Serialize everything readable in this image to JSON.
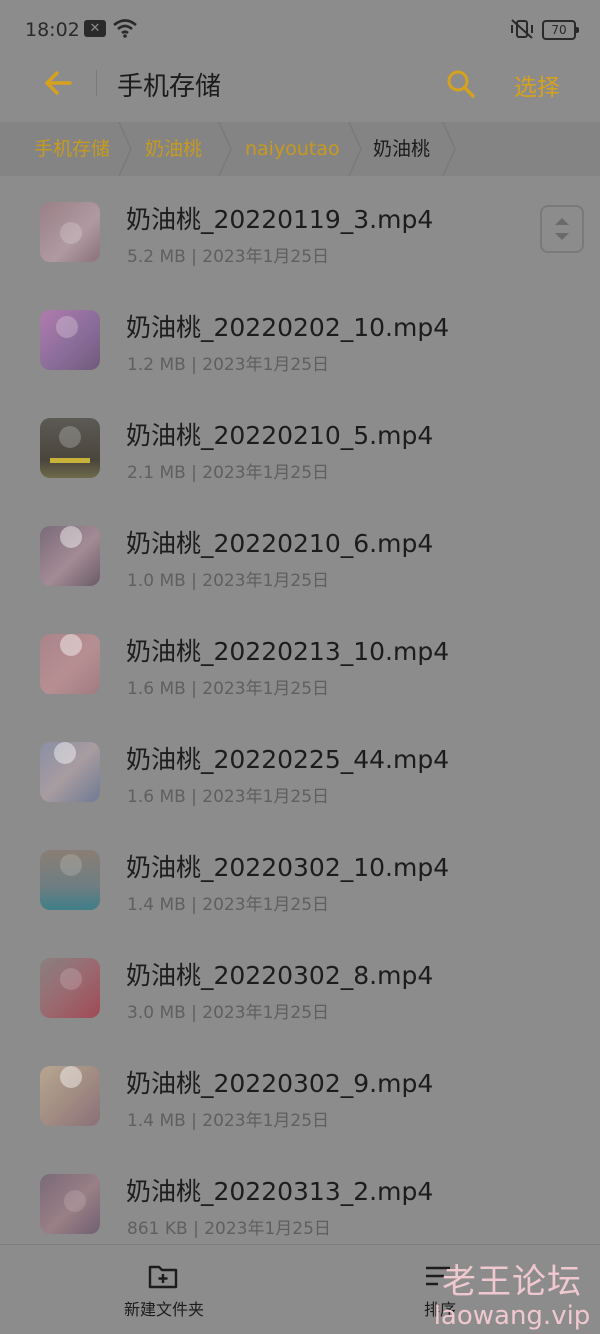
{
  "status_bar": {
    "time": "18:02",
    "battery": "70"
  },
  "header": {
    "title": "手机存储",
    "select_label": "选择"
  },
  "breadcrumb": [
    "手机存储",
    "奶油桃",
    "naiyoutao",
    "奶油桃"
  ],
  "files": [
    {
      "name": "奶油桃_20220119_3.mp4",
      "meta": "5.2 MB | 2023年1月25日"
    },
    {
      "name": "奶油桃_20220202_10.mp4",
      "meta": "1.2 MB | 2023年1月25日"
    },
    {
      "name": "奶油桃_20220210_5.mp4",
      "meta": "2.1 MB | 2023年1月25日"
    },
    {
      "name": "奶油桃_20220210_6.mp4",
      "meta": "1.0 MB | 2023年1月25日"
    },
    {
      "name": "奶油桃_20220213_10.mp4",
      "meta": "1.6 MB | 2023年1月25日"
    },
    {
      "name": "奶油桃_20220225_44.mp4",
      "meta": "1.6 MB | 2023年1月25日"
    },
    {
      "name": "奶油桃_20220302_10.mp4",
      "meta": "1.4 MB | 2023年1月25日"
    },
    {
      "name": "奶油桃_20220302_8.mp4",
      "meta": "3.0 MB | 2023年1月25日"
    },
    {
      "name": "奶油桃_20220302_9.mp4",
      "meta": "1.4 MB | 2023年1月25日"
    },
    {
      "name": "奶油桃_20220313_2.mp4",
      "meta": "861 KB | 2023年1月25日"
    }
  ],
  "bottom_bar": {
    "new_folder_label": "新建文件夹",
    "sort_label": "排序"
  },
  "watermark": {
    "title": "老王论坛",
    "url": "laowang.vip"
  },
  "colors": {
    "accent": "#d6a21e",
    "background": "#8c8c8c",
    "text": "#1c1c1c"
  }
}
